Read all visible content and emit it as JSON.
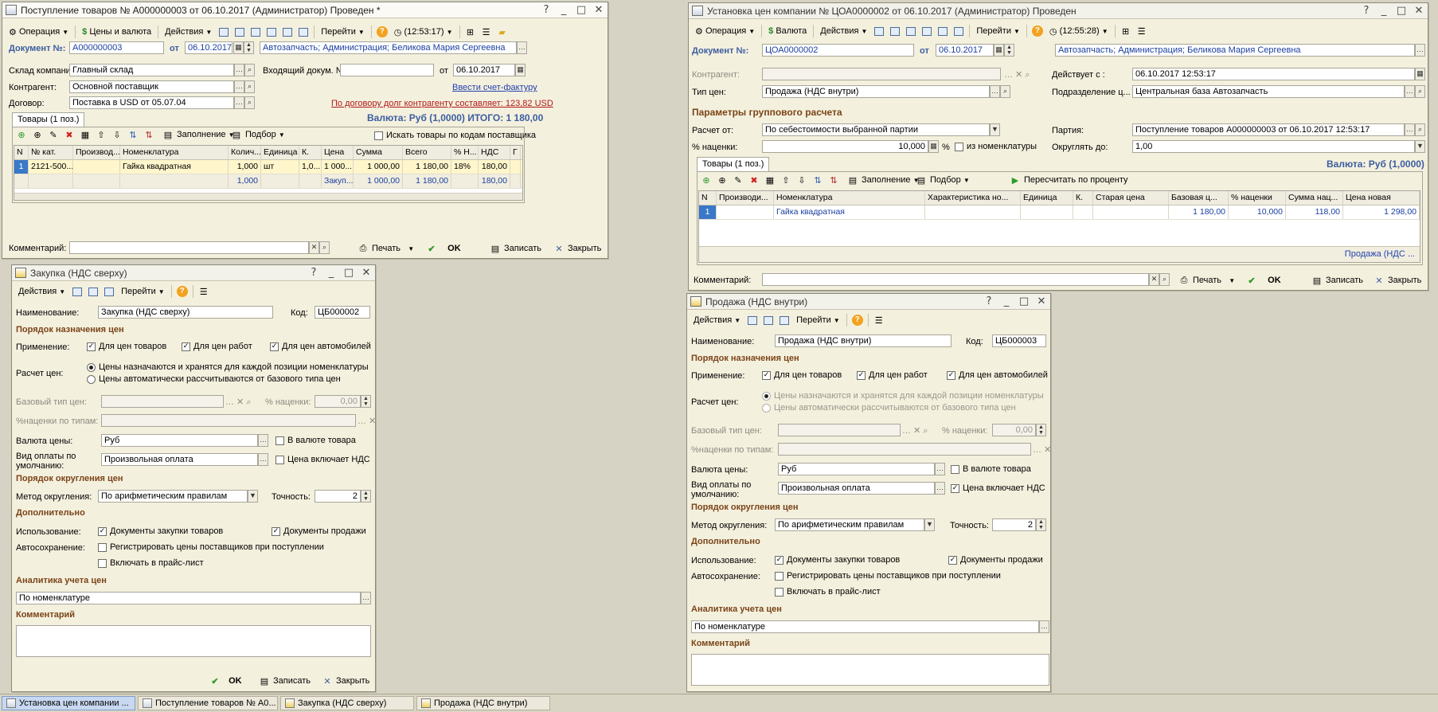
{
  "w1": {
    "title": "Поступление товаров № А000000003 от 06.10.2017 (Администратор) Проведен *",
    "toolbar": [
      "Операция",
      "Цены и валюта",
      "Действия",
      "Перейти",
      "(12:53:17)"
    ],
    "doc_label": "Документ №:",
    "doc_num": "А000000003",
    "ot": "от",
    "doc_date": "06.10.2017",
    "org": "Автозапчасть; Администрация; Беликова Мария Сергеевна",
    "sklad_label": "Склад компании:",
    "sklad": "Главный склад",
    "vhod_label": "Входящий докум. №:",
    "vhod": "",
    "vhod_ot": "от",
    "vhod_date": "06.10.2017",
    "kontr_label": "Контрагент:",
    "kontr": "Основной поставщик",
    "invoice_link": "Ввести счет-фактуру",
    "dogovor_label": "Договор:",
    "dogovor": "Поставка в USD от 05.07.04",
    "debt_link": "По договору долг контрагенту составляет: 123,82 USD",
    "tab": "Товары (1 поз.)",
    "currency_total": "Валюта: Руб (1,0000) ИТОГО: 1 180,00",
    "grid_toolbar": [
      "Заполнение",
      "Подбор"
    ],
    "search_supplier_codes": "Искать товары по кодам поставщика",
    "headers": [
      "N",
      "№ кат.",
      "Производ...",
      "Номенклатура",
      "Колич...",
      "Единица",
      "К.",
      "Цена",
      "Сумма",
      "Всего",
      "% Н...",
      "НДС",
      "Г"
    ],
    "row": [
      "1",
      "2121-500...",
      "",
      "Гайка квадратная",
      "1,000",
      "шт",
      "1,0...",
      "1 000...",
      "1 000,00",
      "1 180,00",
      "18%",
      "180,00",
      ""
    ],
    "footer": [
      "",
      "",
      "",
      "",
      "1,000",
      "",
      "",
      "Закуп...",
      "1 000,00",
      "1 180,00",
      "",
      "180,00",
      ""
    ],
    "comment_label": "Комментарий:",
    "comment": "",
    "print": "Печать",
    "ok": "OK",
    "save": "Записать",
    "close": "Закрыть"
  },
  "w2": {
    "title": "Установка цен компании № ЦОА0000002 от 06.10.2017 (Администратор) Проведен",
    "toolbar": [
      "Операция",
      "Валюта",
      "Действия",
      "Перейти",
      "(12:55:28)"
    ],
    "doc_label": "Документ №:",
    "doc_num": "ЦОА0000002",
    "ot": "от",
    "doc_date": "06.10.2017",
    "org": "Автозапчасть; Администрация; Беликова Мария Сергеевна",
    "kontr_label": "Контрагент:",
    "kontr": "",
    "deist_label": "Действует с :",
    "deist": "06.10.2017 12:53:17",
    "tip_label": "Тип цен:",
    "tip": "Продажа (НДС внутри)",
    "podr_label": "Подразделение ц...",
    "podr": "Центральная база Автозапчасть",
    "params_section": "Параметры группового расчета",
    "raschet_label": "Расчет от:",
    "raschet": "По себестоимости выбранной партии",
    "partiya_label": "Партия:",
    "partiya": "Поступление товаров А000000003 от 06.10.2017 12:53:17",
    "nacenka_label": "% наценки:",
    "nacenka": "10,000",
    "pct": "%",
    "iz_nomen": "из номенклатуры",
    "okrug_label": "Округлять до:",
    "okrug": "1,00",
    "tab": "Товары (1 поз.)",
    "currency": "Валюта: Руб (1,0000)",
    "grid_toolbar": [
      "Заполнение",
      "Подбор",
      "Пересчитать по проценту"
    ],
    "headers": [
      "N",
      "Производи...",
      "Номенклатура",
      "Характеристика но...",
      "Единица",
      "К.",
      "Старая цена",
      "Базовая ц...",
      "% наценки",
      "Сумма нац...",
      "Цена новая"
    ],
    "row": [
      "1",
      "",
      "Гайка квадратная",
      "",
      "",
      "",
      "",
      "1 180,00",
      "10,000",
      "118,00",
      "1 298,00"
    ],
    "footer_note": "Продажа (НДС ...",
    "comment_label": "Комментарий:",
    "comment": "",
    "print": "Печать",
    "ok": "OK",
    "save": "Записать",
    "close": "Закрыть"
  },
  "w3": {
    "title": "Закупка (НДС сверху)",
    "toolbar": [
      "Действия",
      "Перейти"
    ],
    "name_label": "Наименование:",
    "name": "Закупка (НДС сверху)",
    "code_label": "Код:",
    "code": "ЦБ000002",
    "sec_order": "Порядок назначения цен",
    "apply_label": "Применение:",
    "apply": [
      "Для цен товаров",
      "Для цен работ",
      "Для цен автомобилей"
    ],
    "calc_label": "Расчет цен:",
    "calc_opts": [
      "Цены назначаются и хранятся для каждой позиции номенклатуры",
      "Цены автоматически рассчитываются от базового типа цен"
    ],
    "base_label": "Базовый тип цен:",
    "base": "",
    "markup_label": "% наценки:",
    "markup": "0,00",
    "markup_types_label": "%наценки по типам:",
    "markup_types": "",
    "currency_label": "Валюта цены:",
    "currency": "Руб",
    "in_currency": "В валюте товара",
    "pay_label": "Вид оплаты по умолчанию:",
    "pay": "Произвольная оплата",
    "vat_incl": "Цена включает НДС",
    "vat_checked": "",
    "sec_round": "Порядок округления цен",
    "round_label": "Метод округления:",
    "round": "По арифметическим правилам",
    "prec_label": "Точность:",
    "prec": "2",
    "sec_extra": "Дополнительно",
    "use_label": "Использование:",
    "use": [
      "Документы закупки товаров",
      "Документы продажи"
    ],
    "autosave_label": "Автосохранение:",
    "autosave": [
      "Регистрировать цены поставщиков при поступлении",
      "Включать в прайс-лист"
    ],
    "sec_analytics": "Аналитика учета цен",
    "analytics": "По номенклатуре",
    "sec_comment": "Комментарий",
    "comment": "",
    "ok": "OK",
    "save": "Записать",
    "close": "Закрыть"
  },
  "w4": {
    "title": "Продажа (НДС внутри)",
    "toolbar": [
      "Действия",
      "Перейти"
    ],
    "name_label": "Наименование:",
    "name": "Продажа (НДС внутри)",
    "code_label": "Код:",
    "code": "ЦБ000003",
    "sec_order": "Порядок назначения цен",
    "apply_label": "Применение:",
    "apply": [
      "Для цен товаров",
      "Для цен работ",
      "Для цен автомобилей"
    ],
    "calc_label": "Расчет цен:",
    "calc_opts": [
      "Цены назначаются и хранятся для каждой позиции номенклатуры",
      "Цены автоматически рассчитываются от базового типа цен"
    ],
    "base_label": "Базовый тип цен:",
    "base": "",
    "markup_label": "% наценки:",
    "markup": "0,00",
    "markup_types_label": "%наценки по типам:",
    "markup_types": "",
    "currency_label": "Валюта цены:",
    "currency": "Руб",
    "in_currency": "В валюте товара",
    "pay_label": "Вид оплаты по умолчанию:",
    "pay": "Произвольная оплата",
    "vat_incl": "Цена включает НДС",
    "vat_checked": "✓",
    "sec_round": "Порядок округления цен",
    "round_label": "Метод округления:",
    "round": "По арифметическим правилам",
    "prec_label": "Точность:",
    "prec": "2",
    "sec_extra": "Дополнительно",
    "use_label": "Использование:",
    "use": [
      "Документы закупки товаров",
      "Документы продажи"
    ],
    "autosave_label": "Автосохранение:",
    "autosave": [
      "Регистрировать цены поставщиков при поступлении",
      "Включать в прайс-лист"
    ],
    "sec_analytics": "Аналитика учета цен",
    "analytics": "По номенклатуре",
    "sec_comment": "Комментарий",
    "comment": ""
  },
  "taskbar": [
    "Установка цен компании ...",
    "Поступление товаров № А0...",
    "Закупка (НДС сверху)",
    "Продажа (НДС внутри)"
  ],
  "colors": {
    "accent": "#3b5da0",
    "section": "#7a4418",
    "link": "#2342b0",
    "debt": "#b01818",
    "window_bg": "#f4f0de",
    "selected_row": "#fff6cc"
  }
}
